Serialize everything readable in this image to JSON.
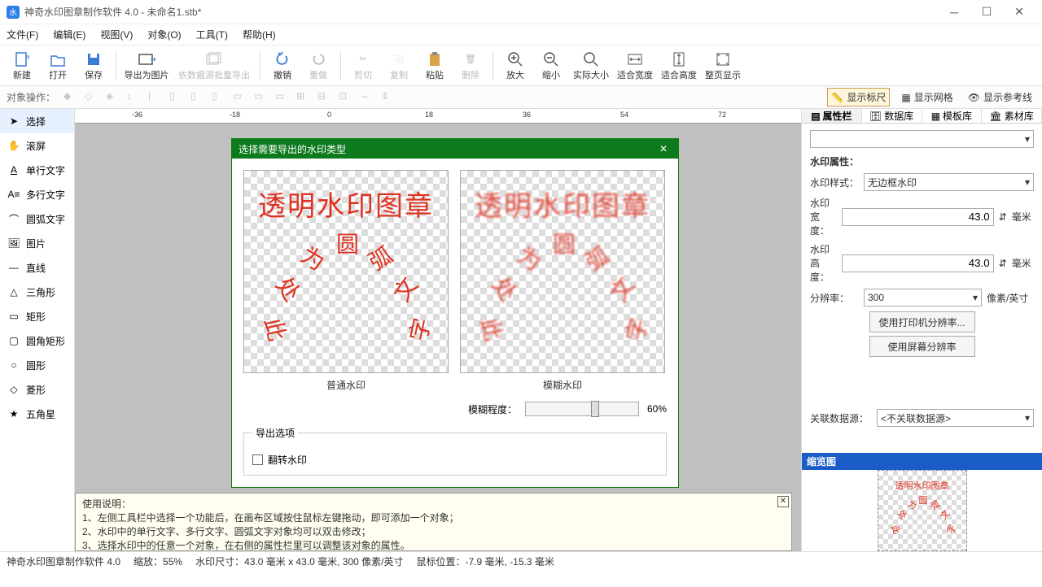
{
  "title": "神奇水印图章制作软件 4.0 - 未命名1.stb*",
  "menu": [
    "文件(F)",
    "编辑(E)",
    "视图(V)",
    "对象(O)",
    "工具(T)",
    "帮助(H)"
  ],
  "toolbar": [
    "新建",
    "打开",
    "保存",
    "导出为图片",
    "依数据源批量导出",
    "撤销",
    "重做",
    "剪切",
    "复制",
    "粘贴",
    "删除",
    "放大",
    "缩小",
    "实际大小",
    "适合宽度",
    "适合高度",
    "整页显示"
  ],
  "objbar_label": "对象操作：",
  "view_toggles": {
    "ruler": "显示标尺",
    "grid": "显示网格",
    "guide": "显示参考线"
  },
  "left_tools": [
    "选择",
    "滚屏",
    "单行文字",
    "多行文字",
    "圆弧文字",
    "图片",
    "直线",
    "三角形",
    "矩形",
    "圆角矩形",
    "圆形",
    "菱形",
    "五角星"
  ],
  "right_tabs": [
    "属性栏",
    "数据库",
    "模板库",
    "素材库"
  ],
  "props": {
    "title": "水印属性：",
    "style_lbl": "水印样式：",
    "style_val": "无边框水印",
    "width_lbl": "水印宽度：",
    "width_val": "43.0",
    "width_unit": "毫米",
    "height_lbl": "水印高度：",
    "height_val": "43.0",
    "height_unit": "毫米",
    "res_lbl": "分辨率：",
    "res_val": "300",
    "res_unit": "像素/英寸",
    "btn_printer": "使用打印机分辨率...",
    "btn_screen": "使用屏幕分辨率",
    "ds_lbl": "关联数据源：",
    "ds_val": "<不关联数据源>"
  },
  "thumb_title": "缩览图",
  "ruler_ticks": [
    "-36",
    "-18",
    "0",
    "18",
    "36",
    "54",
    "72"
  ],
  "help": {
    "tab": "使用说明",
    "title": "使用说明：",
    "l1": "1、左侧工具栏中选择一个功能后，在画布区域按住鼠标左键拖动，即可添加一个对象；",
    "l2": "2、水印中的单行文字、多行文字、圆弧文字对象均可以双击修改；",
    "l3": "3、选择水印中的任意一个对象，在右侧的属性栏里可以调整该对象的属性。"
  },
  "modal": {
    "title": "选择需要导出的水印类型",
    "normal_lbl": "普通水印",
    "blur_lbl": "模糊水印",
    "blur_deg_lbl": "模糊程度：",
    "blur_val": "60%",
    "export_legend": "导出选项",
    "flip_lbl": "翻转水印",
    "wm_text1": "透明水印图章",
    "wm_arc": [
      "此",
      "处",
      "为",
      "圆",
      "弧",
      "文",
      "字"
    ]
  },
  "status": {
    "app": "神奇水印图章制作软件 4.0",
    "zoom": "缩放：55%",
    "size": "水印尺寸：43.0 毫米 x 43.0 毫米, 300 像素/英寸",
    "mouse": "鼠标位置：-7.9 毫米, -15.3 毫米"
  }
}
